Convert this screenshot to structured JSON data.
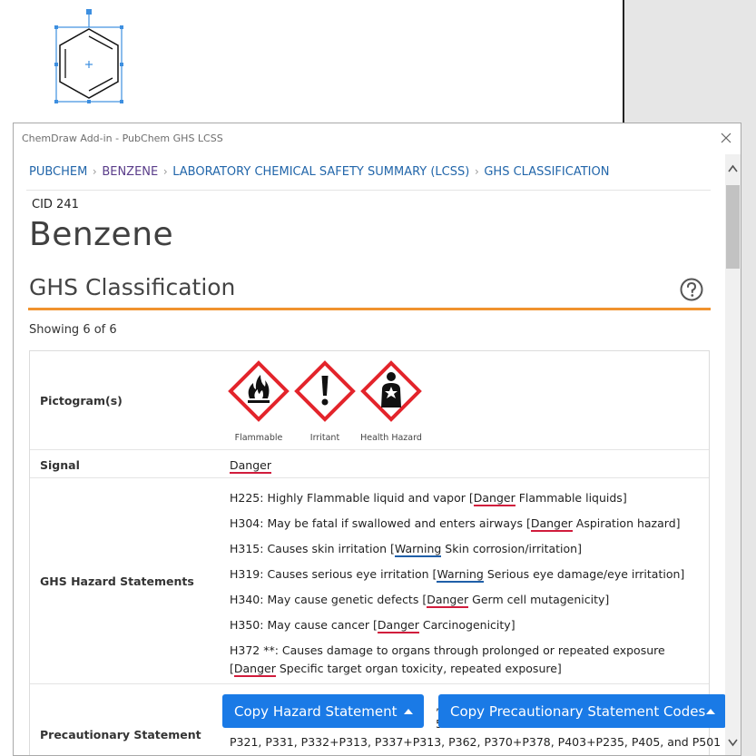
{
  "dialog": {
    "title": "ChemDraw Add-in - PubChem GHS LCSS"
  },
  "breadcrumb": {
    "items": [
      "PUBCHEM",
      "BENZENE",
      "LABORATORY CHEMICAL SAFETY SUMMARY (LCSS)",
      "GHS CLASSIFICATION"
    ]
  },
  "compound": {
    "cid": "CID 241",
    "name": "Benzene"
  },
  "section": {
    "title": "GHS Classification",
    "showing": "Showing 6 of 6"
  },
  "table": {
    "pictogram_label": "Pictogram(s)",
    "pictograms": [
      {
        "name": "Flammable",
        "icon": "flame-icon"
      },
      {
        "name": "Irritant",
        "icon": "exclamation-icon"
      },
      {
        "name": "Health Hazard",
        "icon": "health-hazard-icon"
      }
    ],
    "signal_label": "Signal",
    "signal_value": "Danger",
    "hazard_label": "GHS Hazard Statements",
    "hazards": [
      {
        "pre": "H225: Highly Flammable liquid and vapor [",
        "signal": "Danger",
        "post": " Flammable liquids]"
      },
      {
        "pre": "H304: May be fatal if swallowed and enters airways [",
        "signal": "Danger",
        "post": " Aspiration hazard]"
      },
      {
        "pre": "H315: Causes skin irritation [",
        "signal": "Warning",
        "post": " Skin corrosion/irritation]"
      },
      {
        "pre": "H319: Causes serious eye irritation [",
        "signal": "Warning",
        "post": " Serious eye damage/eye irritation]"
      },
      {
        "pre": "H340: May cause genetic defects [",
        "signal": "Danger",
        "post": " Germ cell mutagenicity]"
      },
      {
        "pre": "H350: May cause cancer [",
        "signal": "Danger",
        "post": " Carcinogenicity]"
      }
    ],
    "hazard_last_line1": "H372 **: Causes damage to organs through prolonged or repeated exposure",
    "hazard_last_line2_open": "[",
    "hazard_last_line2_signal": "Danger",
    "hazard_last_line2_post": " Specific target organ toxicity, repeated exposure]",
    "precaution_label": "Precautionary Statement",
    "precaution_line1_fragment": ", P",
    "precaution_line2_fragment": "51+",
    "precaution_line3": "P321, P331, P332+P313, P337+P313, P362, P370+P378, P403+P235, P405, and P501"
  },
  "buttons": {
    "copy_hazard": "Copy Hazard Statement",
    "copy_precaution": "Copy Precautionary Statement Codes"
  }
}
